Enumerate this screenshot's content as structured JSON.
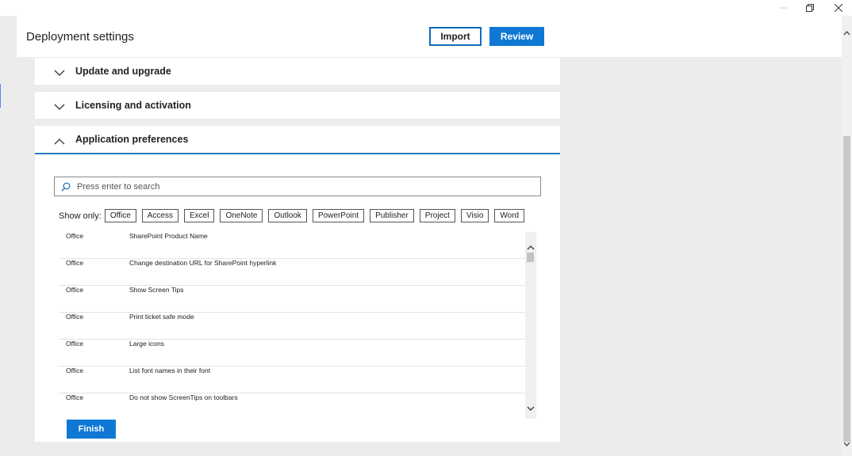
{
  "header": {
    "title": "Deployment settings",
    "import_label": "Import",
    "review_label": "Review"
  },
  "window_controls": {
    "minimize_icon": "minimize-icon",
    "restore_icon": "restore-icon",
    "close_icon": "close-icon"
  },
  "sections": [
    {
      "label": "Update and upgrade",
      "expanded": false
    },
    {
      "label": "Licensing and activation",
      "expanded": false
    },
    {
      "label": "Application preferences",
      "expanded": true
    }
  ],
  "search": {
    "placeholder": "Press enter to search",
    "value": ""
  },
  "filters": {
    "label": "Show only:",
    "chips": [
      "Office",
      "Access",
      "Excel",
      "OneNote",
      "Outlook",
      "PowerPoint",
      "Publisher",
      "Project",
      "Visio",
      "Word"
    ]
  },
  "rows": [
    {
      "app": "Office",
      "setting": "SharePoint Product Name"
    },
    {
      "app": "Office",
      "setting": "Change destination URL for SharePoint hyperlink"
    },
    {
      "app": "Office",
      "setting": "Show Screen Tips"
    },
    {
      "app": "Office",
      "setting": "Print ticket safe mode"
    },
    {
      "app": "Office",
      "setting": "Large icons"
    },
    {
      "app": "Office",
      "setting": "List font names in their font"
    },
    {
      "app": "Office",
      "setting": "Do not show ScreenTips on toolbars"
    }
  ],
  "finish_label": "Finish",
  "colors": {
    "accent": "#0f78d4",
    "section_underline": "#2a7bc4",
    "background": "#ececec"
  }
}
